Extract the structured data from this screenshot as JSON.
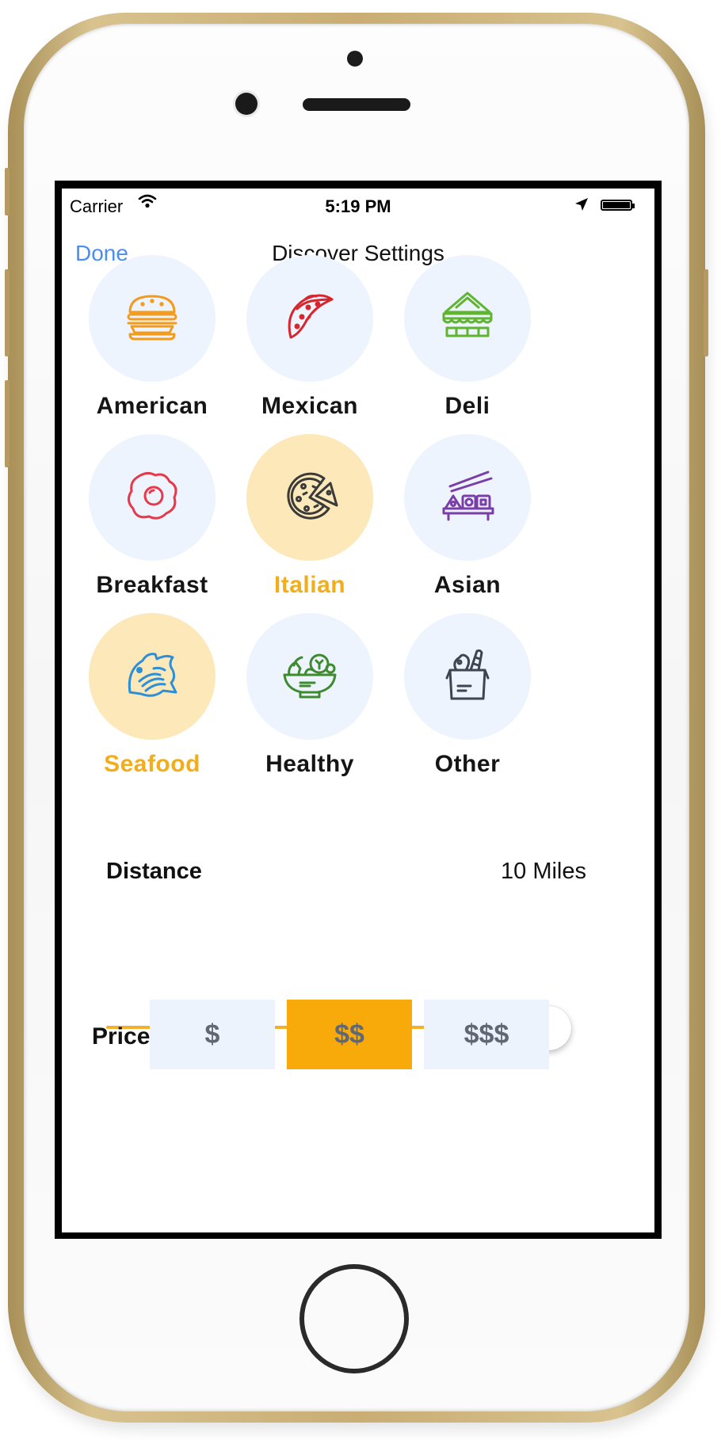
{
  "status_bar": {
    "carrier": "Carrier",
    "time": "5:19 PM"
  },
  "nav": {
    "done_label": "Done",
    "title": "Discover Settings"
  },
  "categories": [
    {
      "label": "American",
      "icon": "burger-icon",
      "selected": false
    },
    {
      "label": "Mexican",
      "icon": "taco-icon",
      "selected": false
    },
    {
      "label": "Deli",
      "icon": "sandwich-icon",
      "selected": false
    },
    {
      "label": "Breakfast",
      "icon": "egg-icon",
      "selected": false
    },
    {
      "label": "Italian",
      "icon": "pizza-icon",
      "selected": true
    },
    {
      "label": "Asian",
      "icon": "sushi-icon",
      "selected": false
    },
    {
      "label": "Seafood",
      "icon": "fish-icon",
      "selected": true
    },
    {
      "label": "Healthy",
      "icon": "salad-bowl-icon",
      "selected": false
    },
    {
      "label": "Other",
      "icon": "grocery-bag-icon",
      "selected": false
    }
  ],
  "distance": {
    "label": "Distance",
    "value": "10 Miles",
    "slider_fraction": 1.0
  },
  "price": {
    "label": "Price",
    "options": [
      {
        "label": "$",
        "selected": false
      },
      {
        "label": "$$",
        "selected": true
      },
      {
        "label": "$$$",
        "selected": false
      }
    ]
  },
  "colors": {
    "accent": "#f8aa0a",
    "selected_label": "#f3ad1a",
    "link": "#4a8ef1",
    "circle_bg": "#edf4fd",
    "circle_selected_bg": "#fce8b8"
  }
}
